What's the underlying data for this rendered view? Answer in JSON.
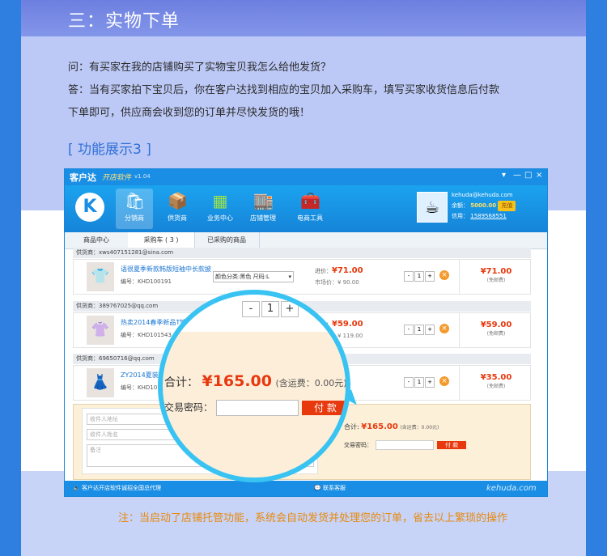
{
  "section_title": "三：实物下单",
  "faq": {
    "question": "问：有买家在我的店铺购买了实物宝贝我怎么给他发货？",
    "answer_line1": "答：当有买家拍下宝贝后，你在客户达找到相应的宝贝加入采购车，填写买家收货信息后付款",
    "answer_line2": "下单即可，供应商会收到您的订单并尽快发货的哦！"
  },
  "feature_title": "[ 功能展示3 ]",
  "app": {
    "title": "客户达",
    "subtitle": "开店软件",
    "version": "v1.04",
    "window_controls": [
      "▾",
      "—",
      "□",
      "×"
    ],
    "toolbar": [
      {
        "label": "分销商",
        "icon": "shopping-bag-icon",
        "glyph": "🛍"
      },
      {
        "label": "供货商",
        "icon": "box-icon",
        "glyph": "📦"
      },
      {
        "label": "业务中心",
        "icon": "grid-icon",
        "glyph": "▦"
      },
      {
        "label": "店铺管理",
        "icon": "store-icon",
        "glyph": "🏬"
      },
      {
        "label": "电商工具",
        "icon": "toolbox-icon",
        "glyph": "🧰"
      }
    ],
    "account": {
      "email": "kehuda@kehuda.com",
      "balance_label": "余额：",
      "balance": "5000.00",
      "recharge": "充值",
      "credit_label": "信用：",
      "credit": "1589568551"
    },
    "tabs": [
      "商品中心",
      "采购车 ( 3 )",
      "已采购的商品"
    ],
    "orders": [
      {
        "supplier": "供货商：xws407151281@sina.com",
        "name": "语很夏季新款韩版短袖中长款披...",
        "code": "编号：KHD100191",
        "sku": "颜色分类:黑色 尺码:L",
        "price_label": "进价：",
        "price": "¥71.00",
        "market": "市场价：¥ 90.00",
        "qty": "1",
        "total": "¥71.00",
        "shipping": "(免邮费)"
      },
      {
        "supplier": "供货商：389767025@qq.com",
        "name": "热卖2014春季新品T恤修身",
        "code": "编号：KHD101543",
        "sku": "",
        "price_label": "进价：",
        "price": "¥59.00",
        "market": "市场价：¥ 119.00",
        "qty": "1",
        "total": "¥59.00",
        "shipping": "(免邮费)"
      },
      {
        "supplier": "供货商：69650716@qq.com",
        "name": "ZY2014夏装新款",
        "code": "编号：KHD101",
        "sku": "",
        "price_label": "进价：",
        "price": "¥35.00",
        "market": "",
        "qty": "1",
        "total": "¥35.00",
        "shipping": "(免邮费)"
      }
    ],
    "form": {
      "address_placeholder": "收件人地址",
      "name_placeholder": "收件人姓名",
      "note_placeholder": "备注",
      "sum_label": "合计:",
      "sum_value": "¥165.00",
      "sum_note": "(含运费：0.00元)",
      "password_label": "交易密码：",
      "pay_button": "付 款"
    },
    "statusbar": {
      "left": "客户达开店软件诚招全国总代理",
      "middle": "联系客服",
      "right": "kehuda.com"
    }
  },
  "magnifier": {
    "qty_minus": "-",
    "qty": "1",
    "qty_plus": "+",
    "sum_label": "合计：",
    "sum_value": "¥165.00",
    "sum_note": "(含运费：0.00元)",
    "password_label": "交易密码：",
    "pay_button": "付 款"
  },
  "note": "注：当启动了店铺托管功能，系统会自动发货并处理您的订单，省去以上繁琐的操作",
  "colors": {
    "accent_blue": "#1a8ee4",
    "price_red": "#e8380d",
    "note_orange": "#e88a0c",
    "magnifier_ring": "#39c3f2"
  }
}
